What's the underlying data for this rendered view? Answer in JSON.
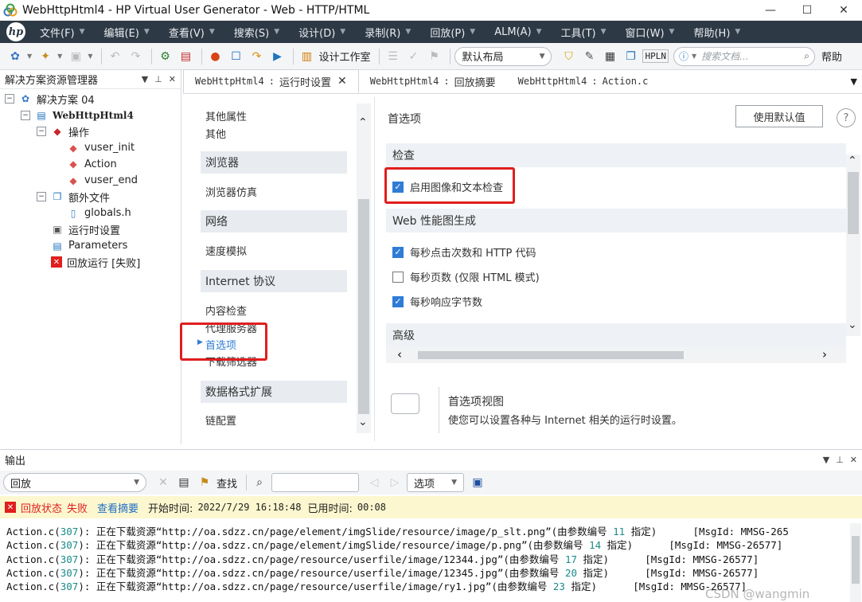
{
  "window": {
    "title": "WebHttpHtml4 - HP Virtual User Generator - Web - HTTP/HTML",
    "minimize": "—",
    "maximize": "☐",
    "close": "✕"
  },
  "menu": [
    "文件(F)",
    "编辑(E)",
    "查看(V)",
    "搜索(S)",
    "设计(D)",
    "录制(R)",
    "回放(P)",
    "ALM(A)",
    "工具(T)",
    "窗口(W)",
    "帮助(H)"
  ],
  "toolbar": {
    "design_studio": "设计工作室",
    "layout": "默认布局",
    "hpln": "HPLN",
    "search_placeholder": "搜索文档...",
    "help": "帮助"
  },
  "solution_explorer": {
    "title": "解决方案资源管理器",
    "items": [
      {
        "label": "解决方案 04"
      },
      {
        "label": "WebHttpHtml4"
      },
      {
        "label": "操作"
      },
      {
        "label": "vuser_init"
      },
      {
        "label": "Action"
      },
      {
        "label": "vuser_end"
      },
      {
        "label": "额外文件"
      },
      {
        "label": "globals.h"
      },
      {
        "label": "运行时设置"
      },
      {
        "label": "Parameters"
      },
      {
        "label": "回放运行 [失败]"
      }
    ]
  },
  "tabs": [
    {
      "script": "WebHttpHtml4",
      "sep": ":",
      "label": "运行时设置"
    },
    {
      "script": "WebHttpHtml4",
      "sep": ":",
      "label": "回放摘要"
    },
    {
      "script": "WebHttpHtml4",
      "sep": ":",
      "label": "Action.c"
    }
  ],
  "nav": {
    "other_props": "其他属性",
    "other": "其他",
    "browser_head": "浏览器",
    "browser_emulation": "浏览器仿真",
    "network_head": "网络",
    "speed_sim": "速度模拟",
    "internet_head": "Internet 协议",
    "content_check": "内容检查",
    "proxy": "代理服务器",
    "preferences": "首选项",
    "download_filter": "下载筛选器",
    "data_format_head": "数据格式扩展",
    "chain_config": "链配置"
  },
  "content": {
    "title": "首选项",
    "use_defaults": "使用默认值",
    "help_icon": "?",
    "check_head": "检查",
    "enable_image_text": "启用图像和文本检查",
    "web_perf_head": "Web 性能图生成",
    "hits_per_sec": "每秒点击次数和 HTTP 代码",
    "pages_per_sec": "每秒页数 (仅限 HTML 模式)",
    "bytes_per_sec": "每秒响应字节数",
    "advanced_head": "高级",
    "desc_title": "首选项视图",
    "desc_text": "使您可以设置各种与 Internet 相关的运行时设置。",
    "checks": {
      "enable_image_text": true,
      "hits_per_sec": true,
      "pages_per_sec": false,
      "bytes_per_sec": true
    }
  },
  "output": {
    "title": "输出",
    "source": "回放",
    "find": "查找",
    "options": "选项",
    "status_label": "回放状态",
    "status_value": "失败",
    "view_summary": "查看摘要",
    "start_label": "开始时间:",
    "start_value": "2022/7/29 16:18:48",
    "elapsed_label": "已用时间:",
    "elapsed_value": "00:08",
    "log": [
      {
        "file": "Action.c",
        "line": "307",
        "msg": "正在下载资源“http://oa.sdzz.cn/page/element/imgSlide/resource/image/p_slt.png”(由参数编号",
        "param": "11",
        "tail": "指定)",
        "msgid": "[MsgId: MMSG-265"
      },
      {
        "file": "Action.c",
        "line": "307",
        "msg": "正在下载资源“http://oa.sdzz.cn/page/element/imgSlide/resource/image/p.png”(由参数编号",
        "param": "14",
        "tail": "指定)",
        "msgid": "[MsgId: MMSG-26577]"
      },
      {
        "file": "Action.c",
        "line": "307",
        "msg": "正在下载资源“http://oa.sdzz.cn/page/resource/userfile/image/12344.jpg”(由参数编号",
        "param": "17",
        "tail": "指定)",
        "msgid": "[MsgId: MMSG-26577]"
      },
      {
        "file": "Action.c",
        "line": "307",
        "msg": "正在下载资源“http://oa.sdzz.cn/page/resource/userfile/image/12345.jpg”(由参数编号",
        "param": "20",
        "tail": "指定)",
        "msgid": "[MsgId: MMSG-26577]"
      },
      {
        "file": "Action.c",
        "line": "307",
        "msg": "正在下载资源“http://oa.sdzz.cn/page/resource/userfile/image/ry1.jpg”(由参数编号",
        "param": "23",
        "tail": "指定)",
        "msgid": "[MsgId: MMSG-26577]"
      }
    ],
    "watermark": "CSDN @wangmin"
  },
  "colors": {
    "menubar": "#2e3946",
    "accent": "#2f7cd6",
    "highlight": "#e01e1e",
    "status_bg": "#fdf7cf"
  }
}
